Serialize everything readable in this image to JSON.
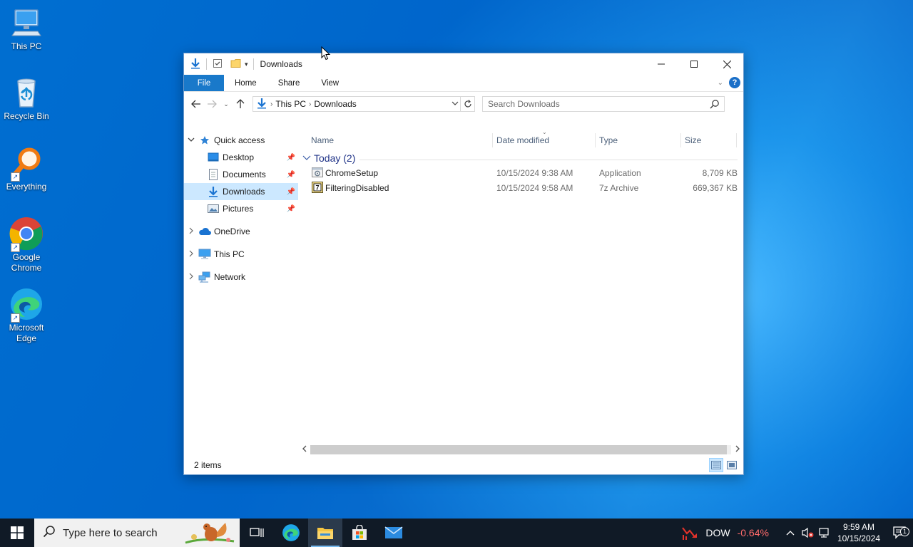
{
  "desktop": {
    "icons": [
      {
        "name": "this-pc",
        "label": "This PC"
      },
      {
        "name": "recycle-bin",
        "label": "Recycle Bin"
      },
      {
        "name": "everything",
        "label": "Everything"
      },
      {
        "name": "google-chrome",
        "label": "Google Chrome"
      },
      {
        "name": "microsoft-edge",
        "label": "Microsoft Edge"
      }
    ]
  },
  "window": {
    "title": "Downloads",
    "ribbon_tabs": [
      "File",
      "Home",
      "Share",
      "View"
    ],
    "help_label": "?",
    "breadcrumb": [
      "This PC",
      "Downloads"
    ],
    "search_placeholder": "Search Downloads",
    "columns": [
      "Name",
      "Date modified",
      "Type",
      "Size"
    ],
    "group": {
      "label": "Today (2)"
    },
    "files": [
      {
        "name": "ChromeSetup",
        "date": "10/15/2024 9:38 AM",
        "type": "Application",
        "size": "8,709 KB",
        "icon": "application-icon"
      },
      {
        "name": "FilteringDisabled",
        "date": "10/15/2024 9:58 AM",
        "type": "7z Archive",
        "size": "669,367 KB",
        "icon": "archive-icon"
      }
    ],
    "nav": {
      "quick_access": "Quick access",
      "quick_items": [
        "Desktop",
        "Documents",
        "Downloads",
        "Pictures"
      ],
      "onedrive": "OneDrive",
      "this_pc": "This PC",
      "network": "Network"
    },
    "status": "2 items"
  },
  "taskbar": {
    "search_placeholder": "Type here to search",
    "stock_name": "DOW",
    "stock_change": "-0.64%",
    "time": "9:59 AM",
    "date": "10/15/2024",
    "notification_count": "1"
  },
  "colors": {
    "accent": "#1979ca",
    "selection": "#cce8ff",
    "group_header": "#1e3287",
    "taskbar": "#101a26",
    "stock_down": "#ff6b6b"
  }
}
